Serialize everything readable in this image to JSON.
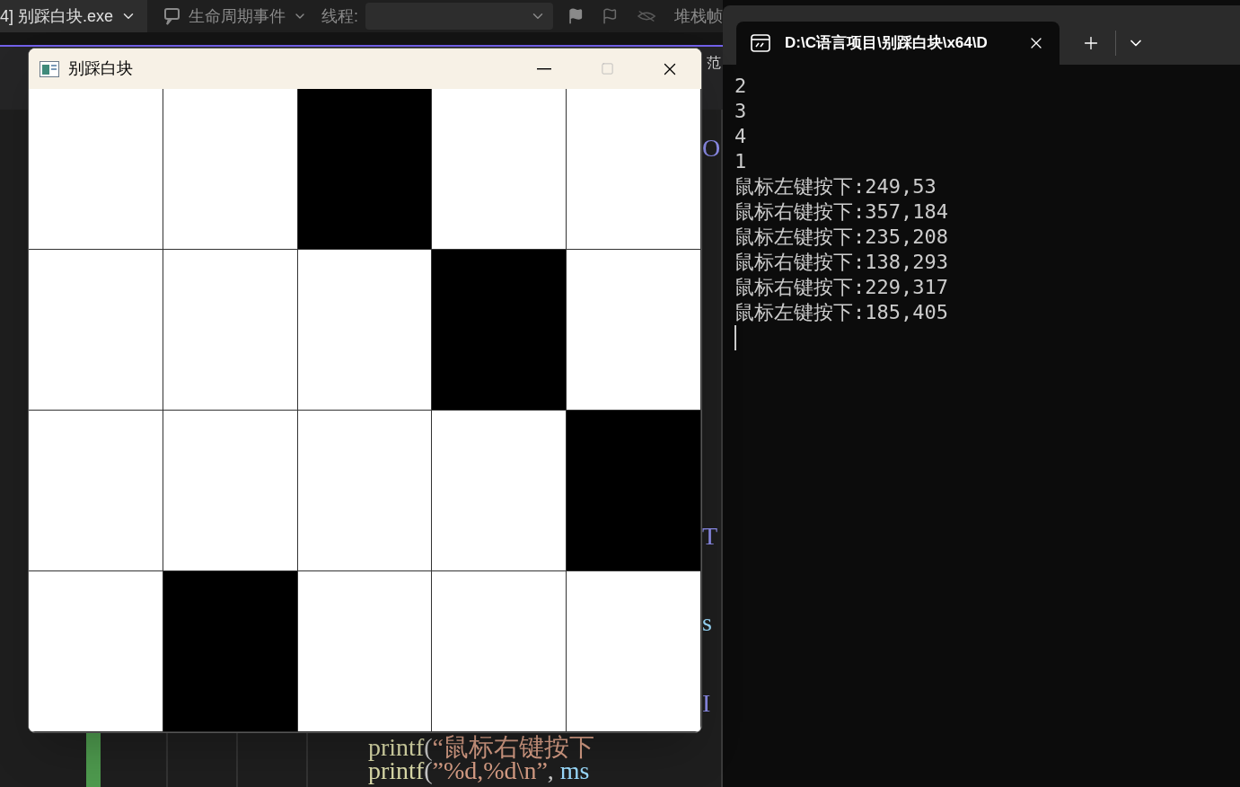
{
  "ide": {
    "toolbar": {
      "process": "4] 别踩白块.exe",
      "lifecycle": "生命周期事件",
      "thread_label": "线程:",
      "stack_label": "堆栈帧"
    },
    "doc_tab": "范",
    "code_lines": [
      {
        "kind": "fragment",
        "segments": [
          {
            "kind": "macro",
            "text": "O"
          }
        ]
      },
      {
        "kind": "fragment",
        "segments": [
          {
            "kind": "macro",
            "text": "T"
          }
        ]
      },
      {
        "kind": "fragment",
        "segments": [
          {
            "kind": "identifier",
            "text": "s"
          }
        ]
      },
      {
        "kind": "fragment",
        "segments": [
          {
            "kind": "macro",
            "text": "I"
          }
        ]
      },
      {
        "kind": "full",
        "segments": [
          {
            "kind": "function",
            "text": "printf"
          },
          {
            "kind": "plain",
            "text": "("
          },
          {
            "kind": "string",
            "text": "“鼠标右键按下"
          }
        ]
      },
      {
        "kind": "full",
        "segments": [
          {
            "kind": "function",
            "text": "printf"
          },
          {
            "kind": "plain",
            "text": "("
          },
          {
            "kind": "string",
            "text": "”%d,%d\\n”"
          },
          {
            "kind": "plain",
            "text": ", "
          },
          {
            "kind": "identifier",
            "text": "ms"
          }
        ]
      }
    ]
  },
  "game_window": {
    "title": "别踩白块",
    "board": [
      [
        {
          "black": false
        },
        {
          "black": false
        },
        {
          "black": true
        },
        {
          "black": false
        },
        {
          "black": false
        }
      ],
      [
        {
          "black": false
        },
        {
          "black": false
        },
        {
          "black": false
        },
        {
          "black": true
        },
        {
          "black": false
        }
      ],
      [
        {
          "black": false
        },
        {
          "black": false
        },
        {
          "black": false
        },
        {
          "black": false
        },
        {
          "black": true
        }
      ],
      [
        {
          "black": false
        },
        {
          "black": true
        },
        {
          "black": false
        },
        {
          "black": false
        },
        {
          "black": false
        }
      ]
    ]
  },
  "terminal": {
    "tab_title": "D:\\C语言项目\\别踩白块\\x64\\D",
    "lines": [
      "2",
      "3",
      "4",
      "1",
      "鼠标左键按下:249,53",
      "鼠标右键按下:357,184",
      "鼠标左键按下:235,208",
      "鼠标右键按下:138,293",
      "鼠标右键按下:229,317",
      "鼠标左键按下:185,405"
    ]
  }
}
